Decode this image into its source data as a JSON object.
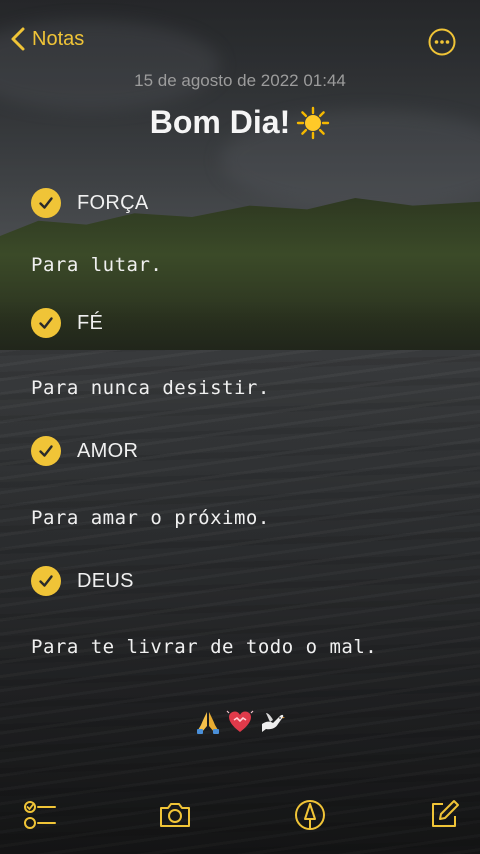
{
  "nav": {
    "back_label": "Notas",
    "back_icon": "chevron-left-icon",
    "more_icon": "ellipsis-circle-icon"
  },
  "note": {
    "date": "15 de agosto de 2022 01:44",
    "title": "Bom Dia!",
    "title_emoji": "sun-emoji",
    "items": [
      {
        "label": "FORÇA",
        "checked": true,
        "text": "Para lutar."
      },
      {
        "label": "FÉ",
        "checked": true,
        "text": "Para nunca desistir."
      },
      {
        "label": "AMOR",
        "checked": true,
        "text": "Para amar o próximo."
      },
      {
        "label": "DEUS",
        "checked": true,
        "text": "Para te livrar de todo o mal."
      }
    ],
    "footer_emojis": [
      "praying-hands-emoji",
      "heart-emoji",
      "dove-emoji"
    ]
  },
  "toolbar": {
    "checklist_icon": "checklist-icon",
    "camera_icon": "camera-icon",
    "markup_icon": "markup-pen-icon",
    "compose_icon": "compose-icon"
  },
  "colors": {
    "accent": "#f0c437",
    "text": "#f0f0f0",
    "date": "#9c9c9c"
  }
}
